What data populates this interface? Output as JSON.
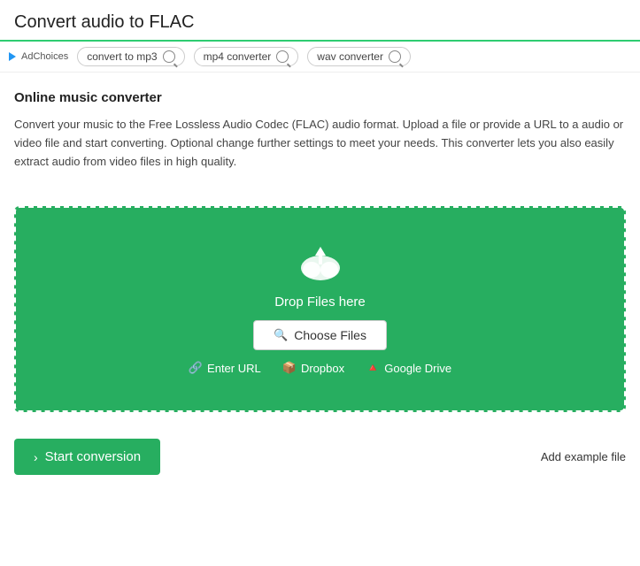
{
  "header": {
    "title": "Convert audio to FLAC"
  },
  "adbar": {
    "ad_label": "AdChoices",
    "tags": [
      {
        "text": "convert to mp3"
      },
      {
        "text": "mp4 converter"
      },
      {
        "text": "wav converter"
      }
    ]
  },
  "content": {
    "section_title": "Online music converter",
    "description": "Convert your music to the Free Lossless Audio Codec (FLAC) audio format. Upload a file or provide a URL to a audio or video file and start converting. Optional change further settings to meet your needs. This converter lets you also easily extract audio from video files in high quality."
  },
  "dropzone": {
    "drop_text": "Drop Files here",
    "choose_files_label": "Choose Files",
    "enter_url_label": "Enter URL",
    "dropbox_label": "Dropbox",
    "google_drive_label": "Google Drive"
  },
  "footer": {
    "start_conversion_label": "Start conversion",
    "add_example_label": "Add example file"
  }
}
